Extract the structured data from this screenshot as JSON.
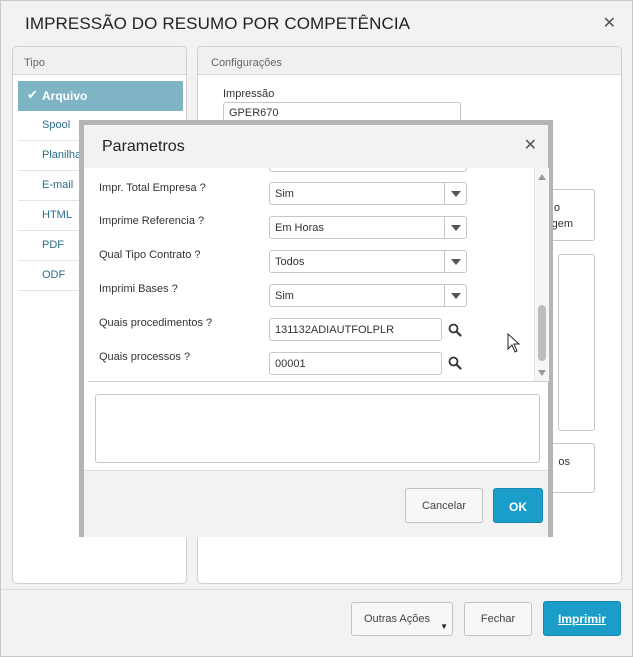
{
  "outer": {
    "title": "IMPRESSÃO DO RESUMO POR COMPETÊNCIA",
    "close_glyph": "✕",
    "tipo_header": "Tipo",
    "tipo_items": [
      {
        "label": "Arquivo",
        "selected": true
      },
      {
        "label": "Spool"
      },
      {
        "label": "Planilha"
      },
      {
        "label": "E-mail"
      },
      {
        "label": "HTML"
      },
      {
        "label": "PDF"
      },
      {
        "label": "ODF"
      }
    ],
    "check_glyph": "✔",
    "config_header": "Configurações",
    "impressao_label": "Impressão",
    "impressao_value": "GPER670",
    "hidden_text_1": "o",
    "hidden_text_2": "gem",
    "hidden_text_3": "os",
    "footer": {
      "outras_label": "Outras Ações",
      "fechar_label": "Fechar",
      "imprimir_label": "Imprimir"
    }
  },
  "modal": {
    "title": "Parametros",
    "close_glyph": "✕",
    "params": [
      {
        "label": "Impr. Total Empresa ?",
        "value": "Sim",
        "kind": "select"
      },
      {
        "label": "Imprime Referencia ?",
        "value": "Em Horas",
        "kind": "select"
      },
      {
        "label": "Qual Tipo Contrato ?",
        "value": "Todos",
        "kind": "select"
      },
      {
        "label": "Imprimi Bases ?",
        "value": "Sim",
        "kind": "select"
      },
      {
        "label": "Quais procedimentos ?",
        "value": "131132ADIAUTFOLPLR",
        "kind": "lookup"
      },
      {
        "label": "Quais processos ?",
        "value": "00001",
        "kind": "lookup"
      }
    ],
    "cancel_label": "Cancelar",
    "ok_label": "OK"
  },
  "colors": {
    "accent": "#1a9ec9",
    "selected_tipo": "#7fb4c5",
    "link_text": "#2a6c8c"
  }
}
